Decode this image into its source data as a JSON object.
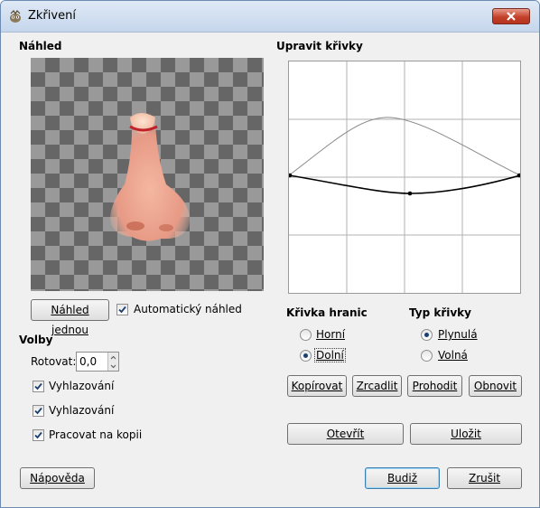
{
  "window": {
    "title": "Zkřivení"
  },
  "preview": {
    "heading": "Náhled",
    "preview_once_button": "Náhled jednou",
    "auto_preview_label": "Automatický náhled",
    "auto_preview_checked": true
  },
  "options": {
    "heading": "Volby",
    "rotate_label": "Rotovat:",
    "rotate_value": "0,0",
    "antialias1_label": "Vyhlazování",
    "antialias1_checked": true,
    "antialias2_label": "Vyhlazování",
    "antialias2_checked": true,
    "work_on_copy_label": "Pracovat na kopii",
    "work_on_copy_checked": true
  },
  "curves": {
    "heading": "Upravit křivky",
    "border_curve": {
      "heading": "Křivka hranic",
      "options": [
        "Horní",
        "Dolní"
      ],
      "selected": "Dolní"
    },
    "curve_type": {
      "heading": "Typ křivky",
      "options": [
        "Plynulá",
        "Volná"
      ],
      "selected": "Plynulá"
    },
    "buttons": [
      "Kopírovat",
      "Zrcadlit",
      "Prohodit",
      "Obnovit"
    ],
    "open_button": "Otevřít",
    "save_button": "Uložit"
  },
  "footer": {
    "help_button": "Nápověda",
    "ok_button": "Budiž",
    "cancel_button": "Zrušit"
  },
  "colors": {
    "title_bg": "#c5d6ec",
    "close_red": "#c4422b",
    "dialog_bg": "#f0f0f0",
    "focus_border": "#3c7fb1"
  }
}
